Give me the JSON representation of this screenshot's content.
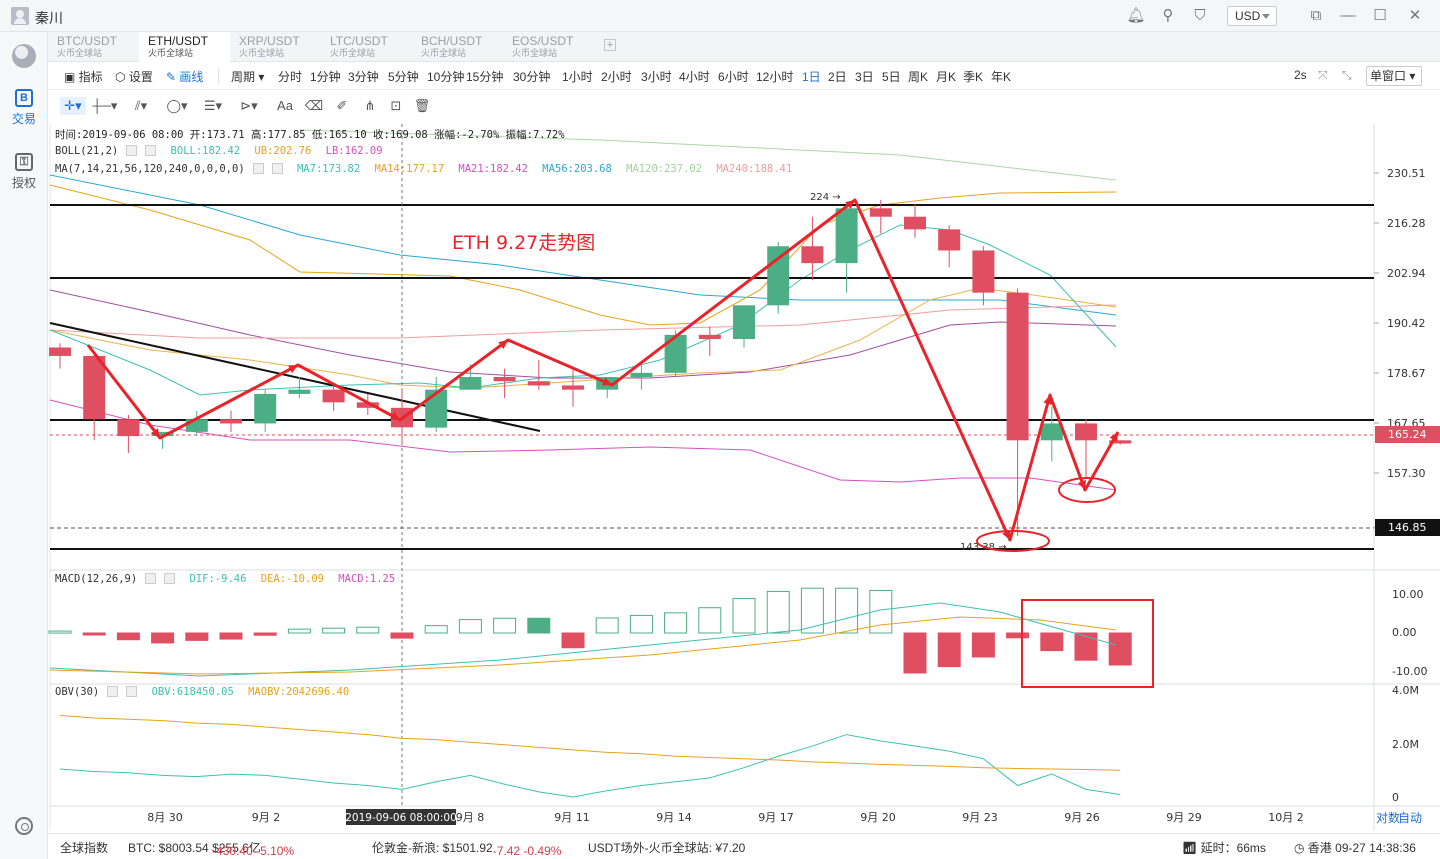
{
  "window": {
    "user_name": "秦川",
    "currency": "USD"
  },
  "sidebar": {
    "items": [
      {
        "label": "交易",
        "glyph": "B"
      },
      {
        "label": "授权",
        "glyph": "⚿"
      }
    ]
  },
  "pairs": [
    {
      "symbol": "BTC/USDT",
      "exchange": "火币全球站"
    },
    {
      "symbol": "ETH/USDT",
      "exchange": "火币全球站"
    },
    {
      "symbol": "XRP/USDT",
      "exchange": "火币全球站"
    },
    {
      "symbol": "LTC/USDT",
      "exchange": "火币全球站"
    },
    {
      "symbol": "BCH/USDT",
      "exchange": "火币全球站"
    },
    {
      "symbol": "EOS/USDT",
      "exchange": "火币全球站"
    }
  ],
  "periodbar": {
    "indicator": "指标",
    "settings": "设置",
    "draw": "画线",
    "period": "周期",
    "periods": [
      "分时",
      "1分钟",
      "3分钟",
      "5分钟",
      "10分钟",
      "15分钟",
      "30分钟",
      "1小时",
      "2小时",
      "3小时",
      "4小时",
      "6小时",
      "12小时",
      "1日",
      "2日",
      "3日",
      "5日",
      "周K",
      "月K",
      "季K",
      "年K"
    ],
    "active_period": "1日",
    "refresh": "2s",
    "window_mode": "单窗口"
  },
  "legend": {
    "info": "时间:2019-09-06 08:00  开:173.71  高:177.85  低:165.10  收:169.08  涨幅:-2.70%  振幅:7.72%",
    "boll": {
      "name": "BOLL(21,2)",
      "boll": "BOLL:182.42",
      "ub": "UB:202.76",
      "lb": "LB:162.09"
    },
    "ma": {
      "name": "MA(7,14,21,56,120,240,0,0,0,0)",
      "ma7": "MA7:173.82",
      "ma14": "MA14:177.17",
      "ma21": "MA21:182.42",
      "ma56": "MA56:203.68",
      "ma120": "MA120:237.02",
      "ma240": "MA240:188.41"
    },
    "macd": {
      "name": "MACD(12,26,9)",
      "dif": "DIF:-9.46",
      "dea": "DEA:-10.09",
      "macd": "MACD:1.25"
    },
    "obv": {
      "name": "OBV(30)",
      "obv": "OBV:618450.05",
      "maobv": "MAOBV:2042696.40"
    }
  },
  "annotations": {
    "title": "ETH 9.27走势图",
    "high_label": "224 →",
    "low_label": "143.38 →",
    "cursor_date": "2019-09-06 08:00:00"
  },
  "price_axis": {
    "ticks": [
      "230.51",
      "216.28",
      "202.94",
      "190.42",
      "178.67",
      "167.65",
      "157.30",
      "146.85"
    ],
    "current": "165.24",
    "line_price": "146.85"
  },
  "macd_axis": [
    "10.00",
    "0.00",
    "-10.00"
  ],
  "obv_axis": [
    "4.0M",
    "2.0M",
    "0"
  ],
  "date_axis": [
    "8月 30",
    "9月 2",
    "9月 8",
    "9月 11",
    "9月 14",
    "9月 17",
    "9月 20",
    "9月 23",
    "9月 26",
    "9月 29",
    "10月 2"
  ],
  "date_controls": {
    "log": "对数",
    "auto": "自动"
  },
  "colors": {
    "up": "#4cae84",
    "down": "#e04e62",
    "accent": "#1f6fd0",
    "annotation": "#e8242a"
  },
  "chart_data": {
    "type": "candlestick",
    "interval": "1d",
    "dates": [
      "8-27",
      "8-28",
      "8-29",
      "8-30",
      "8-31",
      "9-1",
      "9-2",
      "9-3",
      "9-4",
      "9-5",
      "9-6",
      "9-7",
      "9-8",
      "9-9",
      "9-10",
      "9-11",
      "9-12",
      "9-13",
      "9-14",
      "9-15",
      "9-16",
      "9-17",
      "9-18",
      "9-19",
      "9-20",
      "9-21",
      "9-22",
      "9-23",
      "9-24",
      "9-25",
      "9-26",
      "9-27"
    ],
    "ohlc": [
      [
        188,
        189,
        183,
        186
      ],
      [
        186,
        187,
        166,
        171
      ],
      [
        171,
        172,
        163,
        167
      ],
      [
        167,
        168,
        164,
        168
      ],
      [
        168,
        173,
        167,
        171
      ],
      [
        171,
        173,
        168,
        170
      ],
      [
        170,
        178,
        168,
        177
      ],
      [
        177,
        181,
        176,
        178
      ],
      [
        178,
        179,
        173,
        175
      ],
      [
        175,
        177,
        172,
        173.7
      ],
      [
        173.7,
        177.85,
        165.1,
        169.08
      ],
      [
        169,
        181,
        168,
        178
      ],
      [
        178,
        184,
        178,
        181
      ],
      [
        181,
        183,
        176,
        180
      ],
      [
        180,
        185,
        178,
        179
      ],
      [
        179,
        183,
        174,
        178
      ],
      [
        178,
        180,
        176,
        181
      ],
      [
        181,
        184,
        178,
        182
      ],
      [
        182,
        192,
        181,
        191
      ],
      [
        191,
        193,
        186,
        190
      ],
      [
        190,
        197,
        188,
        198
      ],
      [
        198,
        213,
        196,
        212
      ],
      [
        212,
        219,
        204,
        208
      ],
      [
        208,
        222,
        201,
        221
      ],
      [
        221,
        223,
        215,
        219
      ],
      [
        219,
        222,
        214,
        216
      ],
      [
        216,
        217,
        207,
        211
      ],
      [
        211,
        212,
        198,
        201
      ],
      [
        201,
        202,
        143.38,
        166
      ],
      [
        166,
        174,
        161,
        170
      ],
      [
        170,
        171,
        157,
        166
      ],
      [
        166,
        166,
        165,
        165.24
      ]
    ],
    "price_range": [
      140,
      236
    ],
    "macd_hist": [
      0.6,
      -0.5,
      -2.1,
      -3.1,
      -2.3,
      -1.9,
      -0.7,
      1.2,
      1.5,
      1.8,
      -1.6,
      2.3,
      4.2,
      4.6,
      4.6,
      -4.6,
      4.7,
      5.5,
      6.3,
      7.9,
      10.8,
      13.0,
      14.0,
      14.0,
      13.3,
      -12.5,
      -10.5,
      -7.5,
      -1.5,
      -5.5,
      -8.5,
      -10.0
    ],
    "macd_range": [
      -12,
      12
    ],
    "obv_range": [
      0,
      4200000
    ],
    "obv_line": [
      1.1,
      1.0,
      0.95,
      0.85,
      0.8,
      0.9,
      0.85,
      0.7,
      0.55,
      0.45,
      0.3,
      0.6,
      0.85,
      0.5,
      0.2,
      0.0,
      0.25,
      0.45,
      0.6,
      0.75,
      1.15,
      1.6,
      2.0,
      2.45,
      2.2,
      2.0,
      1.8,
      1.5,
      0.45,
      0.9,
      0.3,
      0.1
    ],
    "maobv_line": [
      3.2,
      3.1,
      3.05,
      3.0,
      2.9,
      2.85,
      2.75,
      2.65,
      2.55,
      2.45,
      2.3,
      2.25,
      2.15,
      2.05,
      1.95,
      1.85,
      1.75,
      1.7,
      1.6,
      1.55,
      1.5,
      1.45,
      1.38,
      1.33,
      1.28,
      1.24,
      1.2,
      1.15,
      1.12,
      1.1,
      1.08,
      1.05
    ]
  }
}
